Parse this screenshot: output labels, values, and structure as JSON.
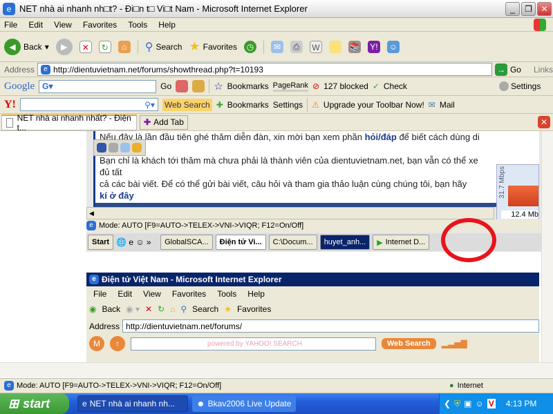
{
  "window": {
    "title": "NET nhà ai nhanh nh□t? - Đi□n t□ Vi□t Nam - Microsoft Internet Explorer"
  },
  "menu": [
    "File",
    "Edit",
    "View",
    "Favorites",
    "Tools",
    "Help"
  ],
  "toolbar": {
    "back": "Back",
    "search": "Search",
    "favorites": "Favorites"
  },
  "address": {
    "label": "Address",
    "url": "http://dientuvietnam.net/forums/showthread.php?t=10193",
    "go": "Go",
    "links": "Links"
  },
  "google": {
    "logo": "Google",
    "go": "Go",
    "bookmarks": "Bookmarks",
    "pagerank": "PageRank",
    "blocked": "127 blocked",
    "check": "Check",
    "settings": "Settings"
  },
  "yahoo": {
    "logo": "Y!",
    "web_search": "Web Search",
    "bookmarks": "Bookmarks",
    "settings": "Settings",
    "upgrade": "Upgrade your Toolbar Now!",
    "mail": "Mail"
  },
  "tabs": {
    "active": "NET nhà ai nhanh nhất? - Điện t...",
    "add": "Add Tab"
  },
  "content": {
    "line1": "Nếu đây là lần đầu tiên ghé thăm diễn đàn, xin mời bạn xem phần ",
    "line1_link": "hỏi/đáp",
    "line1_end": " để biết cách dùng di",
    "line2": "Bạn chỉ là khách tới thăm mà chưa phải là thành viên của dientuvietnam.net, bạn vẫn có thể xe",
    "line3": "đủ tất",
    "line4": "cả các bài viết. Để có thể gửi bài viết, câu hỏi và tham gia thảo luận cùng chúng tôi, bạn hãy",
    "line5_link": "kí ở đây",
    "meter_label": "31.7 Mbps",
    "meter_value": "12.4 Mb",
    "inner_status": "Mode: AUTO [F9=AUTO->TELEX->VNI->VIQR; F12=On/Off]",
    "inner_taskbar": {
      "start": "Start",
      "items": [
        "GlobalSCA...",
        "Điện tử Vi...",
        "C:\\Docum...",
        "huyet_anh...",
        "Internet D..."
      ]
    },
    "second_window": {
      "title": "Điện tử Việt Nam - Microsoft Internet Explorer",
      "menu": [
        "File",
        "Edit",
        "View",
        "Favorites",
        "Tools",
        "Help"
      ],
      "back": "Back",
      "search": "Search",
      "favorites": "Favorites",
      "address_label": "Address",
      "url": "http://dientuvietnam.net/forums/",
      "yahoo_placeholder": "powered by YAHOO! SEARCH",
      "web_search": "Web Search"
    }
  },
  "status": {
    "text": "Mode: AUTO [F9=AUTO->TELEX->VNI->VIQR; F12=On/Off]",
    "zone": "Internet"
  },
  "taskbar": {
    "start": "start",
    "items": [
      "NET nhà ai nhanh nh...",
      "Bkav2006 Live Update"
    ],
    "clock": "4:13 PM"
  },
  "colors": {
    "highlight_circle": "#e8141c",
    "xp_blue": "#245edb",
    "start_green": "#3c9a32"
  }
}
